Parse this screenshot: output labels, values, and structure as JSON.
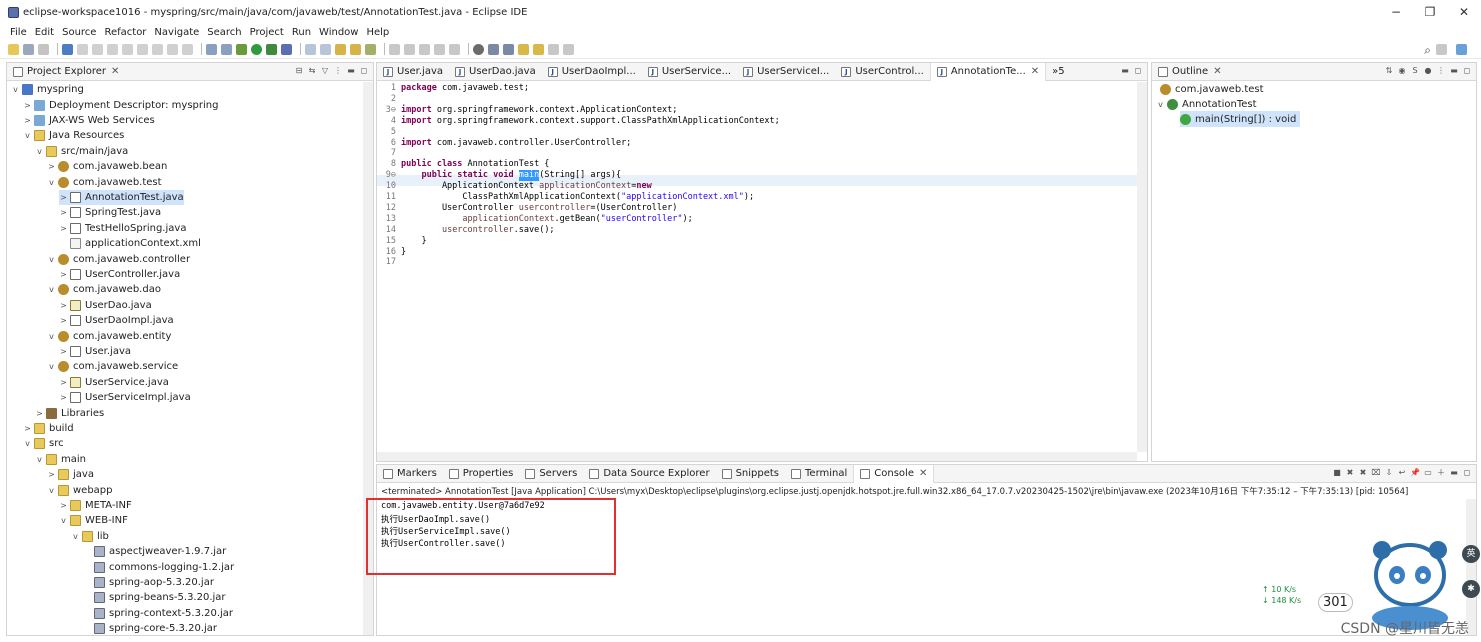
{
  "window": {
    "title": "eclipse-workspace1016 - myspring/src/main/java/com/javaweb/test/AnnotationTest.java - Eclipse IDE",
    "minimize": "−",
    "maximize": "❐",
    "close": "✕"
  },
  "menu": [
    "File",
    "Edit",
    "Source",
    "Refactor",
    "Navigate",
    "Search",
    "Project",
    "Run",
    "Window",
    "Help"
  ],
  "project_explorer": {
    "tab_label": "Project Explorer",
    "items": [
      {
        "label": "myspring",
        "depth": 0,
        "twisty": "v",
        "icon": "proj"
      },
      {
        "label": "Deployment Descriptor: myspring",
        "depth": 1,
        "twisty": ">",
        "icon": "web"
      },
      {
        "label": "JAX-WS Web Services",
        "depth": 1,
        "twisty": ">",
        "icon": "web"
      },
      {
        "label": "Java Resources",
        "depth": 1,
        "twisty": "v",
        "icon": "folder"
      },
      {
        "label": "src/main/java",
        "depth": 2,
        "twisty": "v",
        "icon": "folder"
      },
      {
        "label": "com.javaweb.bean",
        "depth": 3,
        "twisty": ">",
        "icon": "pkg"
      },
      {
        "label": "com.javaweb.test",
        "depth": 3,
        "twisty": "v",
        "icon": "pkg"
      },
      {
        "label": "AnnotationTest.java",
        "depth": 4,
        "twisty": ">",
        "icon": "java",
        "selected": true
      },
      {
        "label": "SpringTest.java",
        "depth": 4,
        "twisty": ">",
        "icon": "java"
      },
      {
        "label": "TestHelloSpring.java",
        "depth": 4,
        "twisty": ">",
        "icon": "java"
      },
      {
        "label": "applicationContext.xml",
        "depth": 4,
        "twisty": "",
        "icon": "xml"
      },
      {
        "label": "com.javaweb.controller",
        "depth": 3,
        "twisty": "v",
        "icon": "pkg"
      },
      {
        "label": "UserController.java",
        "depth": 4,
        "twisty": ">",
        "icon": "java"
      },
      {
        "label": "com.javaweb.dao",
        "depth": 3,
        "twisty": "v",
        "icon": "pkg"
      },
      {
        "label": "UserDao.java",
        "depth": 4,
        "twisty": ">",
        "icon": "iface"
      },
      {
        "label": "UserDaoImpl.java",
        "depth": 4,
        "twisty": ">",
        "icon": "java"
      },
      {
        "label": "com.javaweb.entity",
        "depth": 3,
        "twisty": "v",
        "icon": "pkg"
      },
      {
        "label": "User.java",
        "depth": 4,
        "twisty": ">",
        "icon": "java"
      },
      {
        "label": "com.javaweb.service",
        "depth": 3,
        "twisty": "v",
        "icon": "pkg"
      },
      {
        "label": "UserService.java",
        "depth": 4,
        "twisty": ">",
        "icon": "iface"
      },
      {
        "label": "UserServiceImpl.java",
        "depth": 4,
        "twisty": ">",
        "icon": "java"
      },
      {
        "label": "Libraries",
        "depth": 2,
        "twisty": ">",
        "icon": "lib"
      },
      {
        "label": "build",
        "depth": 1,
        "twisty": ">",
        "icon": "folder"
      },
      {
        "label": "src",
        "depth": 1,
        "twisty": "v",
        "icon": "folder"
      },
      {
        "label": "main",
        "depth": 2,
        "twisty": "v",
        "icon": "folder"
      },
      {
        "label": "java",
        "depth": 3,
        "twisty": ">",
        "icon": "folder"
      },
      {
        "label": "webapp",
        "depth": 3,
        "twisty": "v",
        "icon": "folder"
      },
      {
        "label": "META-INF",
        "depth": 4,
        "twisty": ">",
        "icon": "folder"
      },
      {
        "label": "WEB-INF",
        "depth": 4,
        "twisty": "v",
        "icon": "folder"
      },
      {
        "label": "lib",
        "depth": 5,
        "twisty": "v",
        "icon": "folder"
      },
      {
        "label": "aspectjweaver-1.9.7.jar",
        "depth": 6,
        "twisty": "",
        "icon": "jar"
      },
      {
        "label": "commons-logging-1.2.jar",
        "depth": 6,
        "twisty": "",
        "icon": "jar"
      },
      {
        "label": "spring-aop-5.3.20.jar",
        "depth": 6,
        "twisty": "",
        "icon": "jar"
      },
      {
        "label": "spring-beans-5.3.20.jar",
        "depth": 6,
        "twisty": "",
        "icon": "jar"
      },
      {
        "label": "spring-context-5.3.20.jar",
        "depth": 6,
        "twisty": "",
        "icon": "jar"
      },
      {
        "label": "spring-core-5.3.20.jar",
        "depth": 6,
        "twisty": "",
        "icon": "jar"
      }
    ]
  },
  "editor": {
    "tabs": [
      "User.java",
      "UserDao.java",
      "UserDaoImpl...",
      "UserService...",
      "UserServiceI...",
      "UserControl...",
      "AnnotationTe..."
    ],
    "overflow": "»5",
    "lines": [
      {
        "n": "1",
        "parts": [
          [
            "kw",
            "package"
          ],
          [
            "",
            " com.javaweb.test;"
          ]
        ]
      },
      {
        "n": "2",
        "parts": []
      },
      {
        "n": "3⊖",
        "parts": [
          [
            "kw",
            "import"
          ],
          [
            "",
            " org.springframework.context.ApplicationContext;"
          ]
        ]
      },
      {
        "n": "4",
        "parts": [
          [
            "kw",
            "import"
          ],
          [
            "",
            " org.springframework.context.support.ClassPathXmlApplicationContext;"
          ]
        ]
      },
      {
        "n": "5",
        "parts": []
      },
      {
        "n": "6",
        "parts": [
          [
            "kw",
            "import"
          ],
          [
            "",
            " com.javaweb.controller.UserController;"
          ]
        ]
      },
      {
        "n": "7",
        "parts": []
      },
      {
        "n": "8",
        "parts": [
          [
            "kw",
            "public class"
          ],
          [
            "",
            " AnnotationTest {"
          ]
        ]
      },
      {
        "n": "9⊖",
        "parts": [
          [
            "",
            "    "
          ],
          [
            "kw",
            "public static void"
          ],
          [
            "",
            " "
          ],
          [
            "sel",
            "main"
          ],
          [
            "",
            "(String[] args){"
          ]
        ]
      },
      {
        "n": "10",
        "parts": [
          [
            "",
            "        ApplicationContext "
          ],
          [
            "var",
            "applicationContext"
          ],
          [
            "",
            "="
          ],
          [
            "kw",
            "new"
          ]
        ]
      },
      {
        "n": "11",
        "parts": [
          [
            "",
            "            ClassPathXmlApplicationContext("
          ],
          [
            "str",
            "\"applicationContext.xml\""
          ],
          [
            "",
            ");"
          ]
        ]
      },
      {
        "n": "12",
        "parts": [
          [
            "",
            "        UserController "
          ],
          [
            "var",
            "usercontroller"
          ],
          [
            "",
            "=(UserController)"
          ]
        ]
      },
      {
        "n": "13",
        "parts": [
          [
            "",
            "            "
          ],
          [
            "var",
            "applicationContext"
          ],
          [
            "",
            ".getBean("
          ],
          [
            "str",
            "\"userController\""
          ],
          [
            "",
            ");"
          ]
        ]
      },
      {
        "n": "14",
        "parts": [
          [
            "",
            "        "
          ],
          [
            "var",
            "usercontroller"
          ],
          [
            "",
            ".save();"
          ]
        ]
      },
      {
        "n": "15",
        "parts": [
          [
            "",
            "    }"
          ]
        ]
      },
      {
        "n": "16",
        "parts": [
          [
            "",
            "}"
          ]
        ]
      },
      {
        "n": "17",
        "parts": []
      }
    ]
  },
  "outline": {
    "tab_label": "Outline",
    "items": [
      {
        "label": "com.javaweb.test",
        "indent": 0
      },
      {
        "label": "AnnotationTest",
        "indent": 1
      },
      {
        "label": "main(String[]) : void",
        "indent": 2,
        "selected": true
      }
    ]
  },
  "bottom": {
    "tabs": [
      "Markers",
      "Properties",
      "Servers",
      "Data Source Explorer",
      "Snippets",
      "Terminal",
      "Console"
    ],
    "status": "<terminated> AnnotationTest [Java Application] C:\\Users\\myx\\Desktop\\eclipse\\plugins\\org.eclipse.justj.openjdk.hotspot.jre.full.win32.x86_64_17.0.7.v20230425-1502\\jre\\bin\\javaw.exe  (2023年10月16日 下午7:35:12 – 下午7:35:13) [pid: 10564]",
    "output": [
      "com.javaweb.entity.User@7a6d7e92",
      "执行UserDaoImpl.save()",
      "执行UserServiceImpl.save()",
      "执行UserController.save()"
    ]
  },
  "overlay": {
    "net_up": "↑ 10 K/s",
    "net_down": "↓ 148 K/s",
    "net_value": "301",
    "watermark": "CSDN @星川皆无恙",
    "side_btn_1": "英",
    "side_btn_2": "✱"
  },
  "colors": {
    "accent_selection": "#cfe3fb",
    "highlight_box": "#e2302f",
    "keyword": "#7f0055",
    "string": "#2a00ff"
  }
}
